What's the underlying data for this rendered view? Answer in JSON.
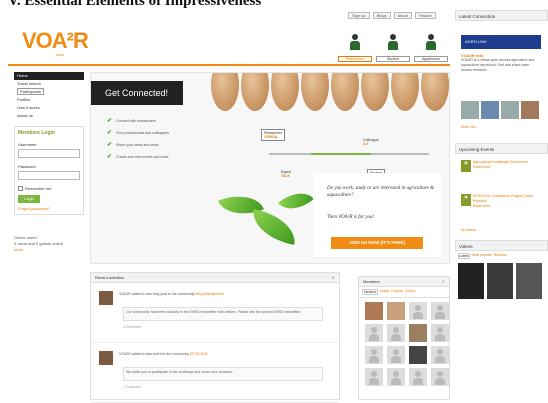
{
  "top_strip_text": "V. Essential Elements of Impressiveness",
  "header": {
    "logo": "VOA²R",
    "logo_sub": "beta",
    "top_links": [
      "Sign up",
      "Blogs",
      "About",
      "Search"
    ],
    "roles": [
      "Researcher",
      "Student",
      "Agripreneur"
    ]
  },
  "nav": {
    "items": [
      "Home",
      "Travel search",
      "Participants",
      "Profiles",
      "How it works",
      "About us"
    ]
  },
  "login": {
    "title": "Members Login",
    "username_label": "Username",
    "password_label": "Password",
    "remember_label": "Remember me",
    "button": "Login",
    "forgot": "Forgot password?"
  },
  "side_extra": {
    "line1": "Online users",
    "line2": "0 users and 0 guests online",
    "link": "more"
  },
  "hero": {
    "title": "Get Connected!",
    "checks": [
      "Connect with researchers",
      "Find professionals and colleagues",
      "Share your ideas and news",
      "Create and view events and news"
    ],
    "nodes": [
      {
        "label": "Researcher",
        "value": "CEREAL"
      },
      {
        "label": "Colleague",
        "value": "ICT"
      },
      {
        "label": "Expert",
        "value": "TALK"
      },
      {
        "label": "Student",
        "value": "AGRO"
      }
    ],
    "cta_text": "Do you work, study or are interested in agriculture & aquaculture?",
    "cta_text2": "Then VOA²R is for you!",
    "cta_button": "JOIN US NOW (IT'S FREE)"
  },
  "activities": {
    "title": "Recent activities",
    "items": [
      {
        "line": "VOA2R added a new blog post to the community",
        "highlight": "Blog Management",
        "quote": "Our community has been included in the ENRD newsletter with articles. Please see the current ENRD newsletter.",
        "meta": "1 Comment"
      },
      {
        "line": "VOA2R added a new event to the community",
        "highlight": "EFITA 2011",
        "quote": "We invite you to participate in the workshop and share your research.",
        "meta": "1 Comment"
      }
    ]
  },
  "members": {
    "title": "Members",
    "tabs": [
      "Newest",
      "Active",
      "Popular",
      "Online"
    ]
  },
  "right": {
    "latest_title": "Latest Connection",
    "ad_text": "AGRO LINK",
    "info_title": "VOA2R Info",
    "info_text": "VOA2R is a virtual open access agriculture and aquaculture repository. Find and share open access research.",
    "more_link": "More info",
    "events_title": "Upcoming Events",
    "events": [
      {
        "title": "Agricultural Knowledge Conference",
        "more": "Read more"
      },
      {
        "title": "EFITA 2011 Conference Prague Czech Republic",
        "more": "Read more"
      }
    ],
    "all_events": "All events",
    "videos_title": "Videos",
    "video_tabs": [
      "Latest",
      "Most popular",
      "Random"
    ]
  },
  "colors": {
    "accent": "#f08c14",
    "green": "#7ab840",
    "dark": "#222222"
  }
}
